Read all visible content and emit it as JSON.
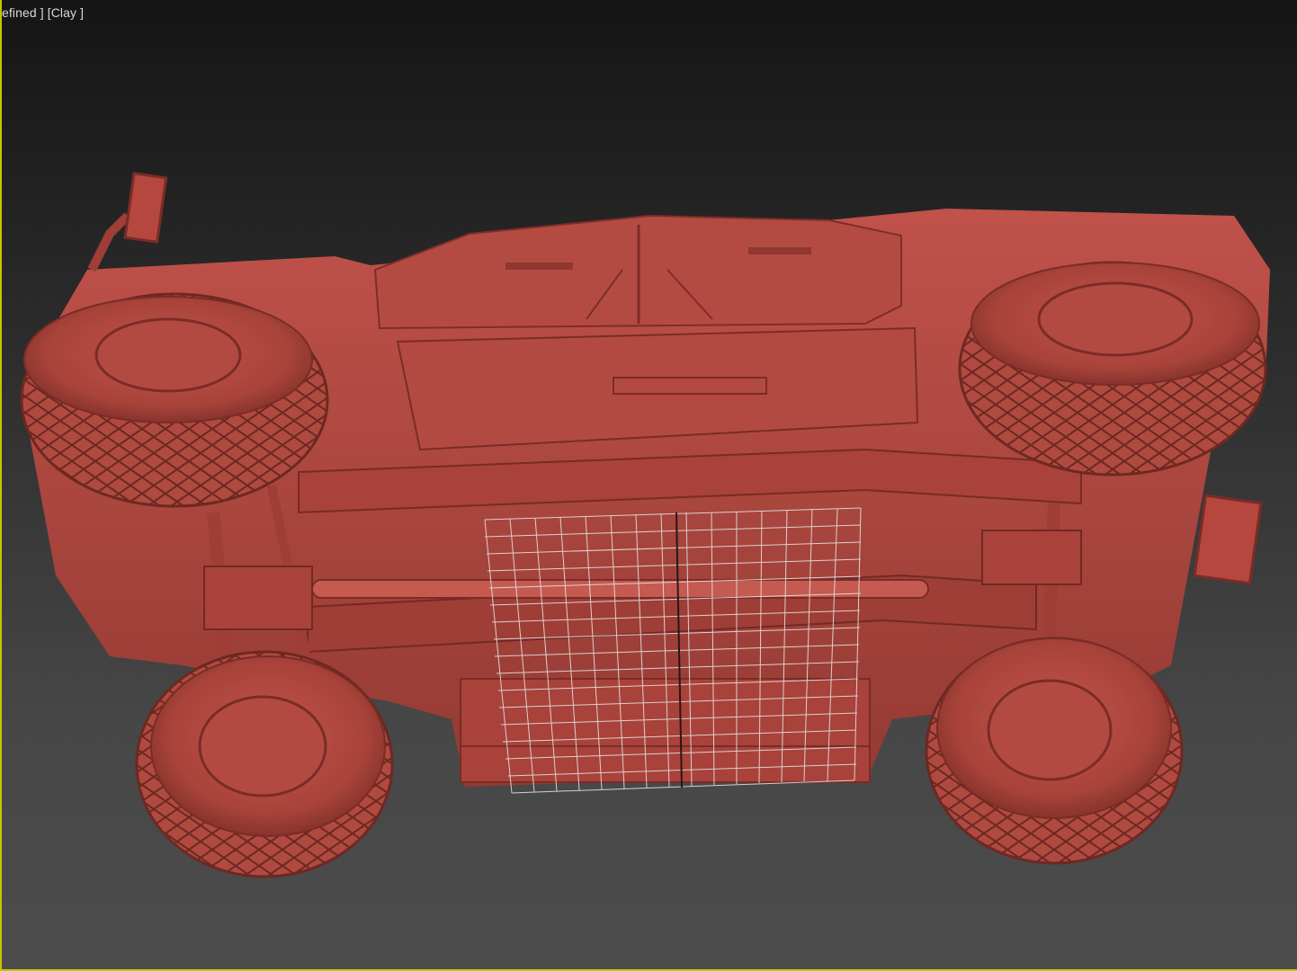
{
  "viewport": {
    "label": "efined ] [Clay ]",
    "shading_mode": "Clay",
    "border_color": "#c8c400",
    "model_color": "#b8483f"
  },
  "icons": {
    "vehicle_model": "armored-vehicle-underside-model",
    "wire_grid": "wireframe-grid"
  }
}
